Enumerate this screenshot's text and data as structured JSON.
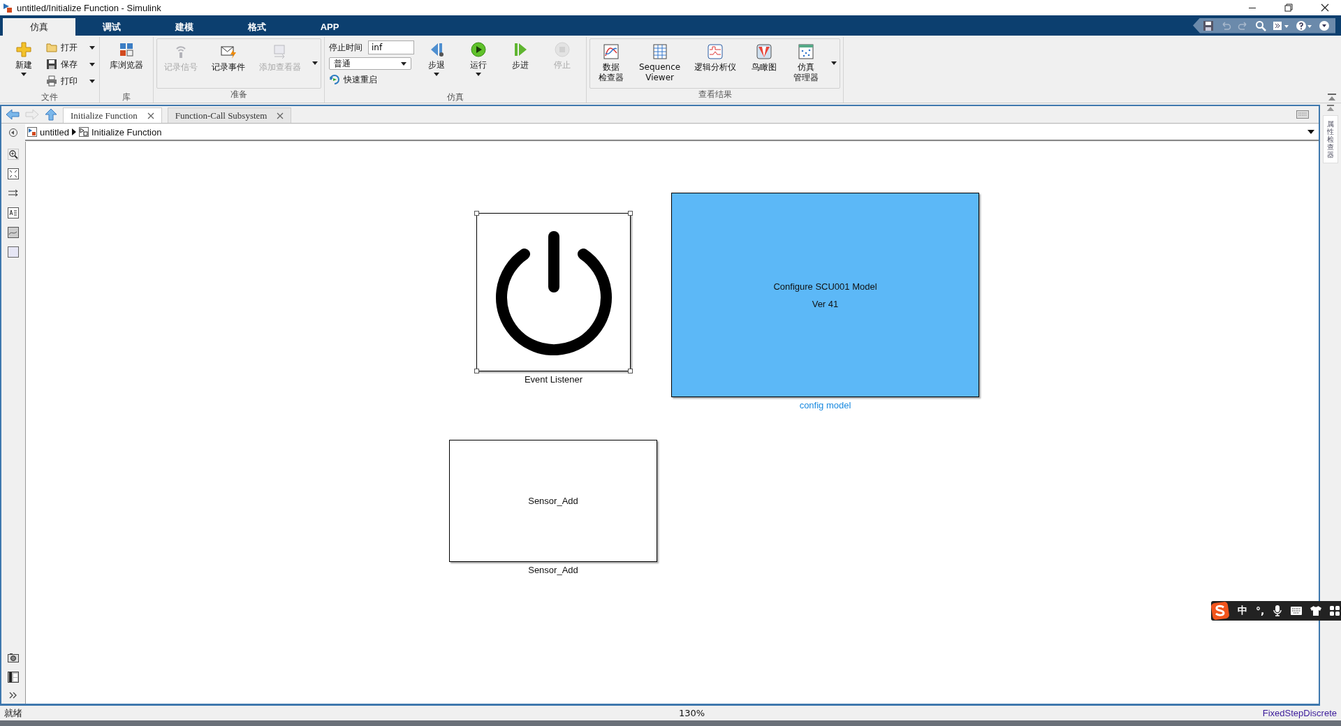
{
  "window": {
    "title": "untitled/Initialize Function - Simulink"
  },
  "ribbon_tabs": [
    {
      "label": "仿真",
      "selected": true
    },
    {
      "label": "调试",
      "selected": false
    },
    {
      "label": "建模",
      "selected": false
    },
    {
      "label": "格式",
      "selected": false
    },
    {
      "label": "APP",
      "selected": false
    }
  ],
  "ribbon_groups": [
    {
      "title": "文件",
      "items": [
        {
          "kind": "large",
          "label": "新建",
          "dropdown": true,
          "disabled": false
        },
        {
          "kind": "small",
          "label": "打开",
          "dropdown": true,
          "disabled": false
        },
        {
          "kind": "small",
          "label": "保存",
          "dropdown": true,
          "disabled": false
        },
        {
          "kind": "small",
          "label": "打印",
          "dropdown": true,
          "disabled": false
        }
      ]
    },
    {
      "title": "库",
      "items": [
        {
          "kind": "large",
          "label": "库浏览器",
          "dropdown": false,
          "disabled": false
        }
      ]
    },
    {
      "title": "准备",
      "panel": true,
      "items": [
        {
          "kind": "large",
          "label": "记录信号",
          "dropdown": false,
          "disabled": true
        },
        {
          "kind": "large",
          "label": "记录事件",
          "dropdown": false,
          "disabled": false
        },
        {
          "kind": "large",
          "label": "添加查看器",
          "dropdown": false,
          "disabled": true
        }
      ]
    },
    {
      "title": "仿真",
      "items": [
        {
          "kind": "field",
          "label": "停止时间",
          "value": "inf"
        },
        {
          "kind": "select",
          "value": "普通"
        },
        {
          "kind": "small",
          "label": "快速重启",
          "dropdown": false,
          "disabled": false
        },
        {
          "kind": "large",
          "label": "步退",
          "dropdown": true,
          "disabled": false
        },
        {
          "kind": "large",
          "label": "运行",
          "dropdown": true,
          "disabled": false
        },
        {
          "kind": "large",
          "label": "步进",
          "dropdown": false,
          "disabled": false
        },
        {
          "kind": "large",
          "label": "停止",
          "dropdown": false,
          "disabled": true
        }
      ]
    },
    {
      "title": "查看结果",
      "panel": true,
      "items": [
        {
          "kind": "large",
          "lines": [
            "数据",
            "检查器"
          ],
          "dropdown": false,
          "disabled": false
        },
        {
          "kind": "large",
          "label": "Sequence\nViewer",
          "dropdown": false,
          "disabled": false
        },
        {
          "kind": "large",
          "label": "逻辑分析仪",
          "dropdown": false,
          "disabled": false
        },
        {
          "kind": "large",
          "label": "鸟瞰图",
          "dropdown": false,
          "disabled": false
        },
        {
          "kind": "large",
          "lines": [
            "仿真",
            "管理器"
          ],
          "dropdown": false,
          "disabled": false
        }
      ]
    }
  ],
  "editor_tabs": [
    {
      "label": "Initialize Function",
      "selected": true
    },
    {
      "label": "Function-Call Subsystem",
      "selected": false
    }
  ],
  "breadcrumb": [
    "untitled",
    "Initialize Function"
  ],
  "blocks": [
    {
      "kind": "power",
      "label": "Event Listener",
      "label_link": false,
      "selected": true,
      "color": "#ffffff"
    },
    {
      "kind": "subsystem",
      "lines": [
        "Configure SCU001 Model",
        "Ver 41"
      ],
      "label": "config model",
      "label_link": true,
      "selected": false,
      "color": "#5cb8f7"
    },
    {
      "kind": "subsystem",
      "lines": [
        "Sensor_Add"
      ],
      "label": "Sensor_Add",
      "label_link": false,
      "selected": false,
      "color": "#ffffff"
    }
  ],
  "ime_bar": {
    "mode": "中",
    "punctuation": "°,"
  },
  "property_inspector": {
    "label": "属性检查器"
  },
  "status_bar": {
    "status": "就绪",
    "zoom": "130%",
    "solver": "FixedStepDiscrete"
  }
}
